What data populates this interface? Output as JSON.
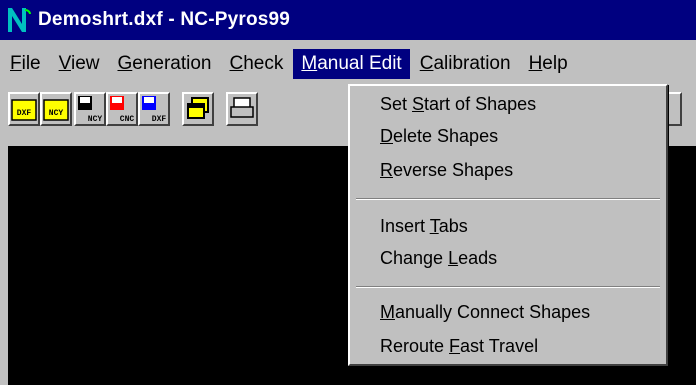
{
  "window": {
    "title": "Demoshrt.dxf - NC-Pyros99"
  },
  "menubar": {
    "items": [
      {
        "label": "File"
      },
      {
        "label": "View"
      },
      {
        "label": "Generation"
      },
      {
        "label": "Check"
      },
      {
        "label": "Manual Edit"
      },
      {
        "label": "Calibration"
      },
      {
        "label": "Help"
      }
    ],
    "active": "Manual Edit"
  },
  "toolbar": {
    "buttons": [
      {
        "icon": "open-dxf-folder-icon",
        "label": "DXF"
      },
      {
        "icon": "open-ncy-folder-icon",
        "label": "NCY"
      },
      {
        "icon": "save-ncy-disk-icon",
        "label": "NCY"
      },
      {
        "icon": "save-cnc-disk-icon",
        "label": "CNC"
      },
      {
        "icon": "save-dxf-disk-icon",
        "label": "DXF"
      },
      {
        "icon": "windows-icon",
        "label": ""
      },
      {
        "icon": "print-icon",
        "label": ""
      }
    ]
  },
  "manual_edit_menu": {
    "items": [
      {
        "label": "Set Start of Shapes",
        "mnemonic": "S"
      },
      {
        "label": "Delete Shapes",
        "mnemonic": "D"
      },
      {
        "label": "Reverse Shapes",
        "mnemonic": "R"
      },
      {
        "label": "Insert Tabs",
        "mnemonic": "T"
      },
      {
        "label": "Change Leads",
        "mnemonic": "L"
      },
      {
        "label": "Manually Connect Shapes",
        "mnemonic": "M"
      },
      {
        "label": "Reroute Fast Travel",
        "mnemonic": "F"
      }
    ]
  },
  "colors": {
    "title_bar": "#000080",
    "menu_highlight": "#000080",
    "workspace": "#000000",
    "face": "#c0c0c0",
    "folder_yellow": "#ffff00",
    "disk_red": "#ff0000",
    "disk_blue": "#0000ff"
  }
}
